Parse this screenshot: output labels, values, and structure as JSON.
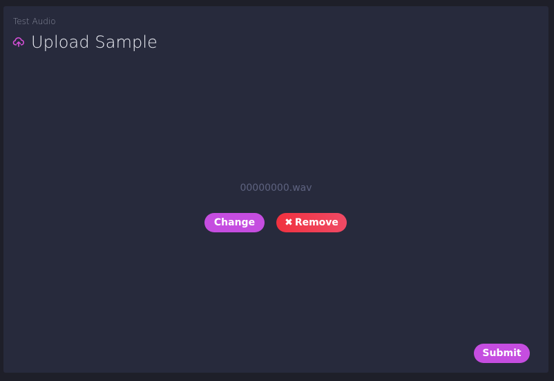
{
  "header": {
    "subtitle": "Test Audio",
    "title": "Upload Sample",
    "icon": "cloud-upload-icon"
  },
  "upload": {
    "filename": "00000000.wav",
    "change_label": "Change",
    "remove_label": "Remove",
    "remove_icon": "close-icon"
  },
  "footer": {
    "submit_label": "Submit"
  },
  "colors": {
    "background": "#1e1f29",
    "card": "#272a3c",
    "accent": "#c54de0",
    "danger": "#f0313f",
    "muted_text": "#5e6380"
  }
}
